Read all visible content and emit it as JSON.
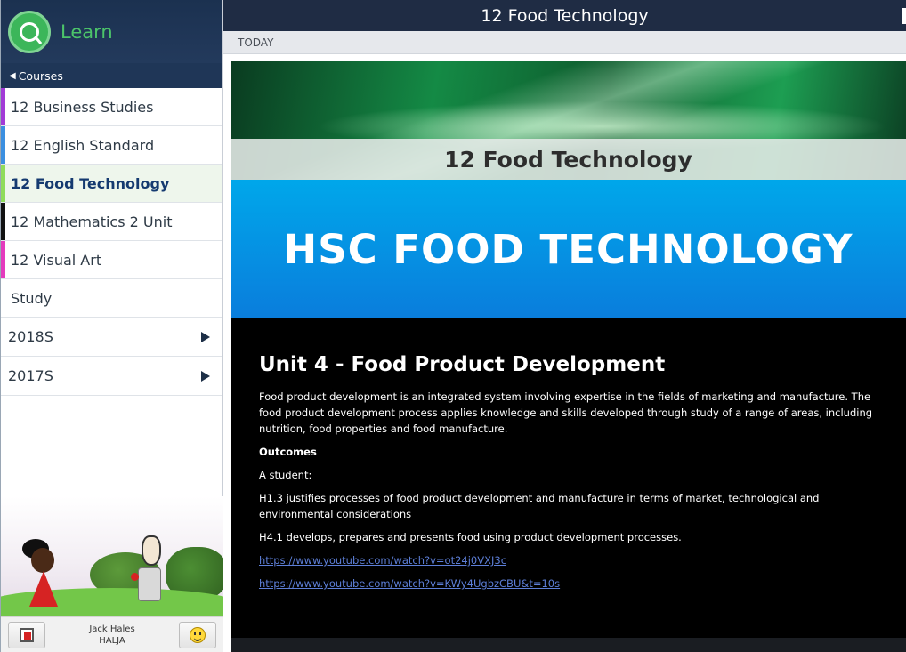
{
  "sidebar": {
    "brand_title": "Learn",
    "courses_label": "Courses",
    "courses": [
      {
        "label": "12 Business Studies",
        "color": "#a23bd6"
      },
      {
        "label": "12 English Standard",
        "color": "#3b8fe0"
      },
      {
        "label": "12 Food Technology",
        "color": "#8fdc5a",
        "active": true
      },
      {
        "label": "12 Mathematics 2 Unit",
        "color": "#111111"
      },
      {
        "label": "12 Visual Art",
        "color": "#e43bbd"
      }
    ],
    "study_label": "Study",
    "groups": [
      {
        "label": "2018S"
      },
      {
        "label": "2017S"
      }
    ],
    "user": {
      "name": "Jack Hales",
      "code": "HALJA"
    }
  },
  "header": {
    "title": "12 Food Technology"
  },
  "today_label": "TODAY",
  "banner": {
    "title": "12 Food Technology"
  },
  "hero": {
    "title": "HSC FOOD TECHNOLOGY"
  },
  "content": {
    "heading": "Unit 4 - Food Product Development",
    "intro": "Food product development is an integrated system involving expertise in the fields of marketing and manufacture. The food product development process applies knowledge and skills developed through study of a range of areas, including nutrition, food properties and food manufacture.",
    "outcomes_label": "Outcomes",
    "student_label": "A student:",
    "outcome_1": "H1.3 justifies processes of food product development and manufacture in terms of market, technological and environmental considerations",
    "outcome_2": "H4.1 develops, prepares and presents food using product development processes.",
    "link_1": "https://www.youtube.com/watch?v=ot24j0VXJ3c",
    "link_2": "https://www.youtube.com/watch?v=KWy4UgbzCBU&t=10s"
  }
}
